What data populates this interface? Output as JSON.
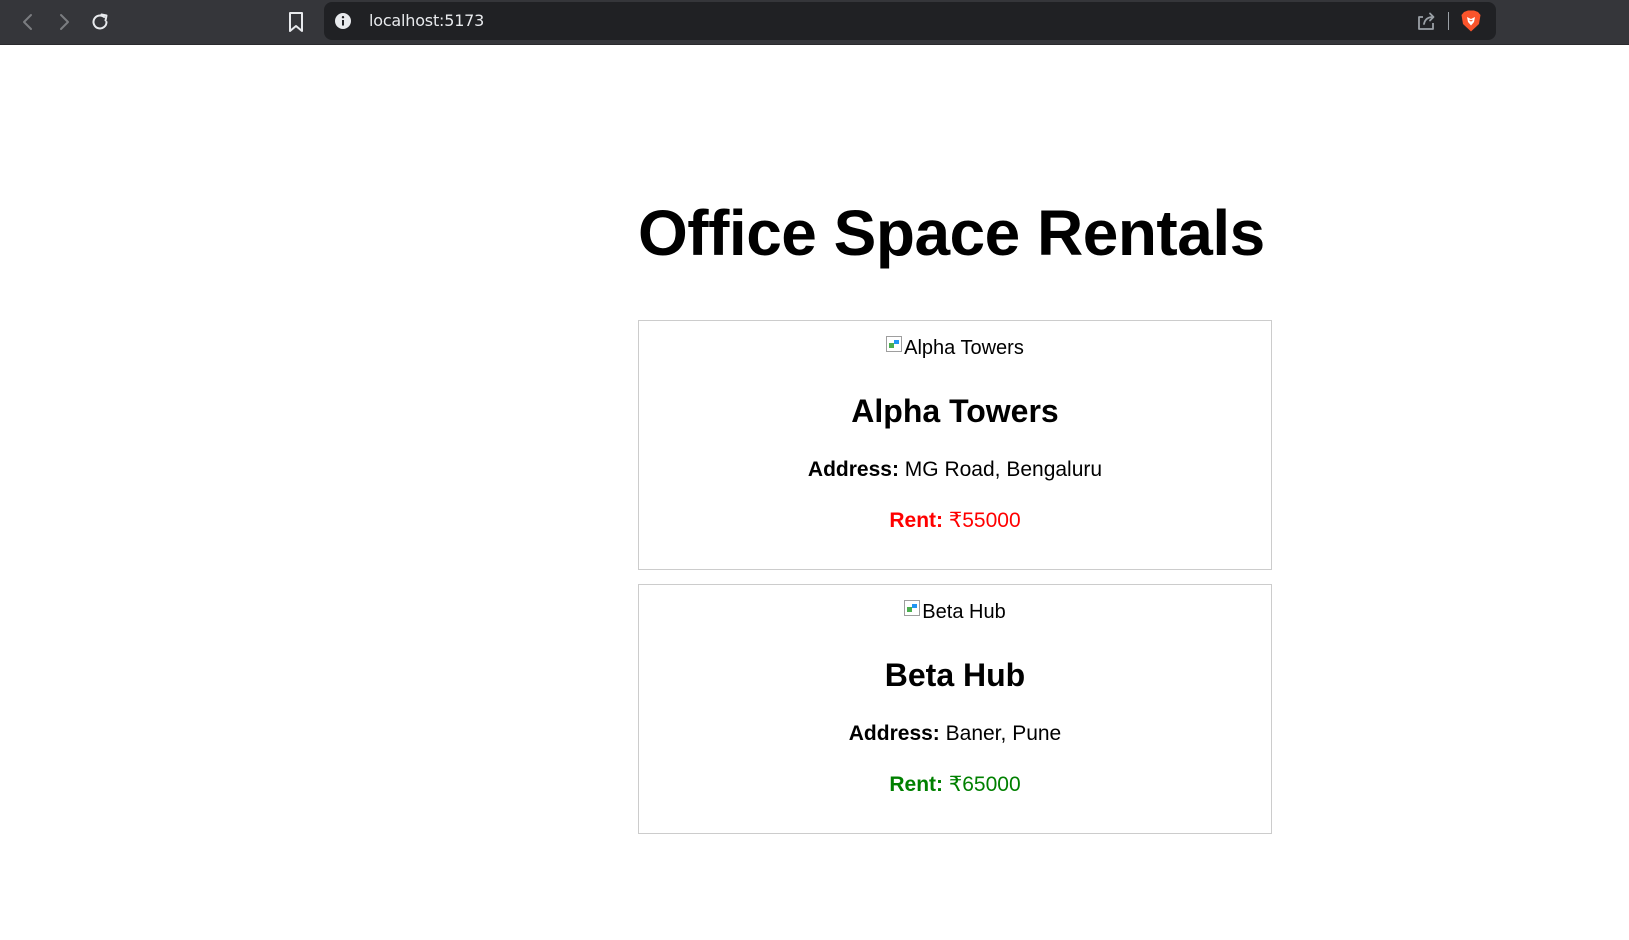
{
  "browser": {
    "url": "localhost:5173"
  },
  "page": {
    "title": "Office Space Rentals"
  },
  "listings": [
    {
      "image_alt": "Alpha Towers",
      "name": "Alpha Towers",
      "address_label": "Address:",
      "address": "MG Road, Bengaluru",
      "rent_label": "Rent:",
      "rent": "₹55000",
      "rent_color": "#ff0000"
    },
    {
      "image_alt": "Beta Hub",
      "name": "Beta Hub",
      "address_label": "Address:",
      "address": "Baner, Pune",
      "rent_label": "Rent:",
      "rent": "₹65000",
      "rent_color": "#008000"
    }
  ],
  "colors": {
    "toolbar_bg": "#35363a",
    "omnibox_bg": "#202124",
    "brave_orange": "#fb542b"
  }
}
